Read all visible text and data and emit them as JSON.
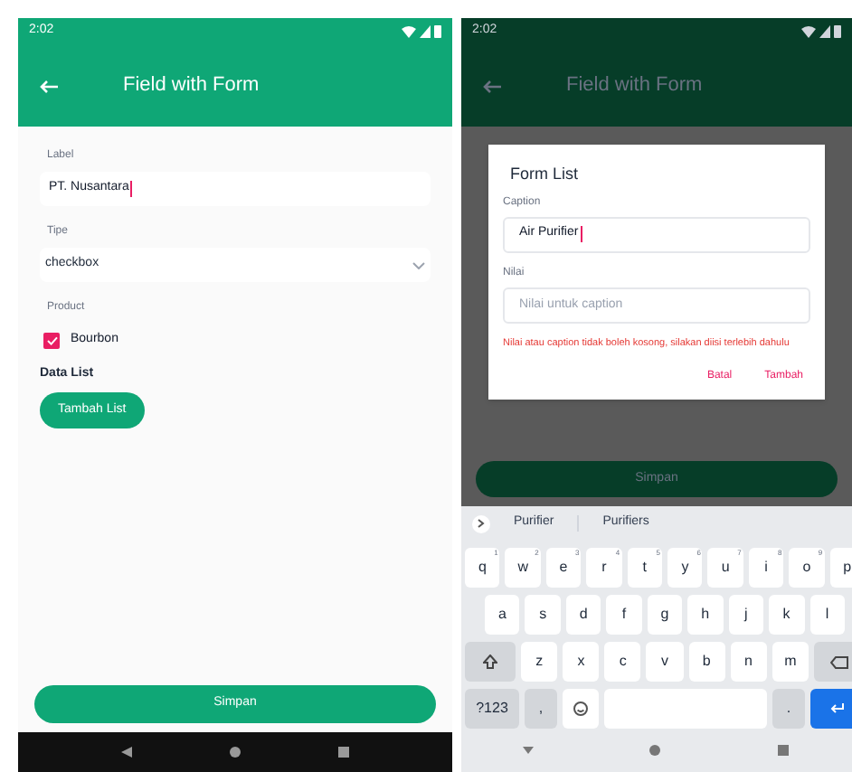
{
  "form_screen": {
    "status_time": "2:02",
    "title": "Field with Form",
    "label_field": {
      "label": "Label",
      "value": "PT. Nusantara"
    },
    "type_field": {
      "label": "Tipe",
      "value": "checkbox"
    },
    "product": {
      "label": "Product",
      "option": "Bourbon",
      "checked": true
    },
    "data_list_label": "Data List",
    "add_button": "Tambah List",
    "save_button": "Simpan"
  },
  "dialog_screen": {
    "status_time": "2:02",
    "title": "Field with Form",
    "dialog": {
      "title": "Form List",
      "caption_field": {
        "label": "Caption",
        "value": "Air Purifier"
      },
      "value_field": {
        "label": "Nilai",
        "placeholder": "Nilai untuk caption"
      },
      "error": "Nilai atau caption tidak boleh kosong, silakan diisi terlebih dahulu",
      "buttons": [
        "Batal",
        "Tambah"
      ]
    },
    "save_button": "Simpan",
    "keyboard": {
      "suggestions": [
        "Purifier",
        "Purifiers"
      ],
      "rows": [
        {
          "keys": [
            {
              "kind": "letter",
              "label": "q",
              "hint": "1"
            },
            {
              "kind": "letter",
              "label": "w",
              "hint": "2"
            },
            {
              "kind": "letter",
              "label": "e",
              "hint": "3"
            },
            {
              "kind": "letter",
              "label": "r",
              "hint": "4"
            },
            {
              "kind": "letter",
              "label": "t",
              "hint": "5"
            },
            {
              "kind": "letter",
              "label": "y",
              "hint": "6"
            },
            {
              "kind": "letter",
              "label": "u",
              "hint": "7"
            },
            {
              "kind": "letter",
              "label": "i",
              "hint": "8"
            },
            {
              "kind": "letter",
              "label": "o",
              "hint": "9"
            },
            {
              "kind": "letter",
              "label": "p"
            }
          ]
        },
        {
          "keys": [
            {
              "kind": "letter",
              "label": "a"
            },
            {
              "kind": "letter",
              "label": "s"
            },
            {
              "kind": "letter",
              "label": "d"
            },
            {
              "kind": "letter",
              "label": "f"
            },
            {
              "kind": "letter",
              "label": "g"
            },
            {
              "kind": "letter",
              "label": "h"
            },
            {
              "kind": "letter",
              "label": "j"
            },
            {
              "kind": "letter",
              "label": "k"
            },
            {
              "kind": "letter",
              "label": "l"
            }
          ]
        },
        {
          "keys": [
            {
              "kind": "shift"
            },
            {
              "kind": "letter",
              "label": "z"
            },
            {
              "kind": "letter",
              "label": "x"
            },
            {
              "kind": "letter",
              "label": "c"
            },
            {
              "kind": "letter",
              "label": "v"
            },
            {
              "kind": "letter",
              "label": "b"
            },
            {
              "kind": "letter",
              "label": "n"
            },
            {
              "kind": "letter",
              "label": "m"
            },
            {
              "kind": "backspace"
            }
          ]
        },
        {
          "keys": [
            {
              "kind": "symbols",
              "label": "?123"
            },
            {
              "kind": "punct",
              "label": ","
            },
            {
              "kind": "emoji"
            },
            {
              "kind": "space"
            },
            {
              "kind": "punct",
              "label": "."
            },
            {
              "kind": "enter"
            }
          ]
        }
      ]
    }
  }
}
